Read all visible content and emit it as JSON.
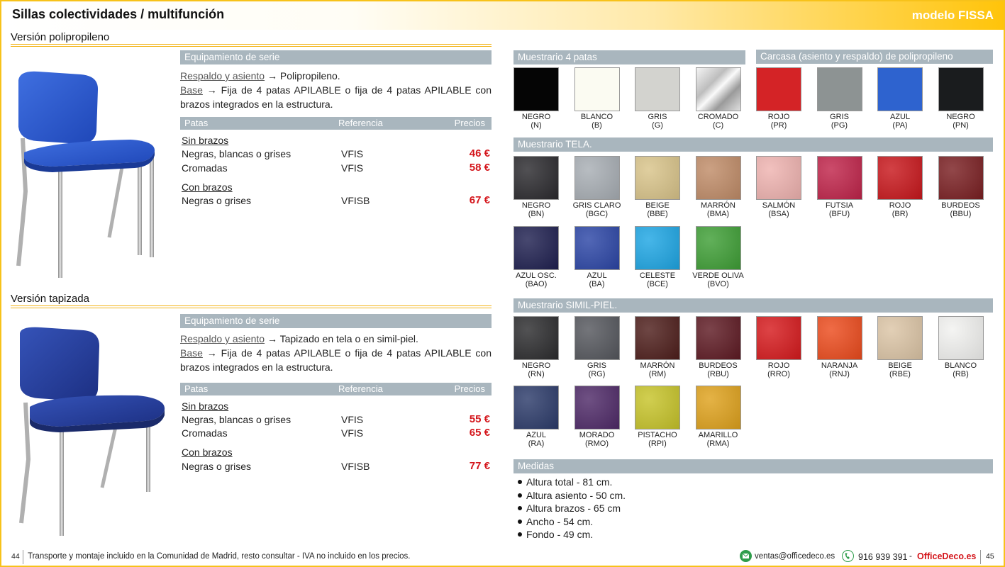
{
  "header": {
    "title": "Sillas colectividades / multifunción",
    "model": "modelo FISSA"
  },
  "sections": {
    "pp_title": "Versión polipropileno",
    "tap_title": "Versión tapizada"
  },
  "pp": {
    "equip_title": "Equipamiento de serie",
    "respaldo_label": "Respaldo y asiento",
    "respaldo_value": "→ Polipropileno.",
    "base_label": "Base",
    "base_value": "→ Fija de 4 patas APILABLE o fija de 4 patas APILABLE con brazos integrados en la estructura.",
    "col_patas": "Patas",
    "col_ref": "Referencia",
    "col_precios": "Precios",
    "sin_brazos": "Sin brazos",
    "row1_label": "Negras, blancas o grises",
    "row1_ref": "VFIS",
    "row1_price": "46 €",
    "row2_label": "Cromadas",
    "row2_ref": "VFIS",
    "row2_price": "58 €",
    "con_brazos": "Con brazos",
    "row3_label": "Negras o grises",
    "row3_ref": "VFISB",
    "row3_price": "67 €"
  },
  "tap": {
    "equip_title": "Equipamiento de serie",
    "respaldo_label": "Respaldo y asiento",
    "respaldo_value": "→ Tapizado en tela o en simil-piel.",
    "base_label": "Base",
    "base_value": "→ Fija de 4 patas APILABLE o fija de 4 patas APILABLE con brazos integrados en la estructura.",
    "col_patas": "Patas",
    "col_ref": "Referencia",
    "col_precios": "Precios",
    "sin_brazos": "Sin brazos",
    "row1_label": "Negras, blancas o grises",
    "row1_ref": "VFIS",
    "row1_price": "55 €",
    "row2_label": "Cromadas",
    "row2_ref": "VFIS",
    "row2_price": "65 €",
    "con_brazos": "Con brazos",
    "row3_label": "Negras o grises",
    "row3_ref": "VFISB",
    "row3_price": "77 €"
  },
  "muestrario_patas": {
    "title": "Muestrario 4 patas",
    "items": [
      {
        "name": "NEGRO",
        "code": "(N)",
        "color": "#050505"
      },
      {
        "name": "BLANCO",
        "code": "(B)",
        "color": "#fbfbf2"
      },
      {
        "name": "GRIS",
        "code": "(G)",
        "color": "#d3d3cf"
      },
      {
        "name": "CROMADO",
        "code": "(C)",
        "color": "#c8c8c8"
      }
    ]
  },
  "carcasa": {
    "title": "Carcasa (asiento y respaldo) de polipropileno",
    "items": [
      {
        "name": "ROJO",
        "code": "(PR)",
        "color": "#d42326"
      },
      {
        "name": "GRIS",
        "code": "(PG)",
        "color": "#8d9393"
      },
      {
        "name": "AZUL",
        "code": "(PA)",
        "color": "#2e63cf"
      },
      {
        "name": "NEGRO",
        "code": "(PN)",
        "color": "#1a1c1e"
      }
    ]
  },
  "tela": {
    "title": "Muestrario TELA.",
    "items": [
      {
        "name": "NEGRO",
        "code": "(BN)",
        "color": "#2b2a2e"
      },
      {
        "name": "GRIS CLARO",
        "code": "(BGC)",
        "color": "#a8aeb4"
      },
      {
        "name": "BEIGE",
        "code": "(BBE)",
        "color": "#d9c48a"
      },
      {
        "name": "MARRÓN",
        "code": "(BMA)",
        "color": "#c08c68"
      },
      {
        "name": "SALMÓN",
        "code": "(BSA)",
        "color": "#efb3b0"
      },
      {
        "name": "FUTSIA",
        "code": "(BFU)",
        "color": "#c0244a"
      },
      {
        "name": "ROJO",
        "code": "(BR)",
        "color": "#c8171c"
      },
      {
        "name": "BURDEOS",
        "code": "(BBU)",
        "color": "#7a1f22"
      },
      {
        "name": "AZUL OSC.",
        "code": "(BAO)",
        "color": "#1f2050"
      },
      {
        "name": "AZUL",
        "code": "(BA)",
        "color": "#2c46a6"
      },
      {
        "name": "CELESTE",
        "code": "(BCE)",
        "color": "#1ea6e4"
      },
      {
        "name": "VERDE OLIVA",
        "code": "(BVO)",
        "color": "#3f9f36"
      }
    ]
  },
  "simil": {
    "title": "Muestrario SIMIL-PIEL.",
    "items": [
      {
        "name": "NEGRO",
        "code": "(RN)",
        "color": "#2c2c2e"
      },
      {
        "name": "GRIS",
        "code": "(RG)",
        "color": "#55575d"
      },
      {
        "name": "MARRÓN",
        "code": "(RM)",
        "color": "#4e1e1b"
      },
      {
        "name": "BURDEOS",
        "code": "(RBU)",
        "color": "#5e1a23"
      },
      {
        "name": "ROJO",
        "code": "(RRO)",
        "color": "#d61a1d"
      },
      {
        "name": "NARANJA",
        "code": "(RNJ)",
        "color": "#ec4b1d"
      },
      {
        "name": "BEIGE",
        "code": "(RBE)",
        "color": "#dcc5a6"
      },
      {
        "name": "BLANCO",
        "code": "(RB)",
        "color": "#f2f2f0"
      },
      {
        "name": "AZUL",
        "code": "(RA)",
        "color": "#2c3b6a"
      },
      {
        "name": "MORADO",
        "code": "(RMO)",
        "color": "#4f2a68"
      },
      {
        "name": "PISTACHO",
        "code": "(RPI)",
        "color": "#c7c42a"
      },
      {
        "name": "AMARILLO",
        "code": "(RMA)",
        "color": "#dfa21d"
      }
    ]
  },
  "medidas": {
    "title": "Medidas",
    "items": [
      "Altura total - 81 cm.",
      "Altura asiento - 50 cm.",
      "Altura brazos - 65 cm",
      "Ancho - 54 cm.",
      "Fondo - 49 cm."
    ]
  },
  "footer": {
    "page_left": "44",
    "note": "Transporte y montaje incluido en la Comunidad de Madrid, resto consultar - IVA no incluido en los precios.",
    "email": "ventas@officedeco.es",
    "phone": "916 939 391",
    "dash": "-",
    "brand": "OfficeDeco.es",
    "page_right": "45"
  }
}
